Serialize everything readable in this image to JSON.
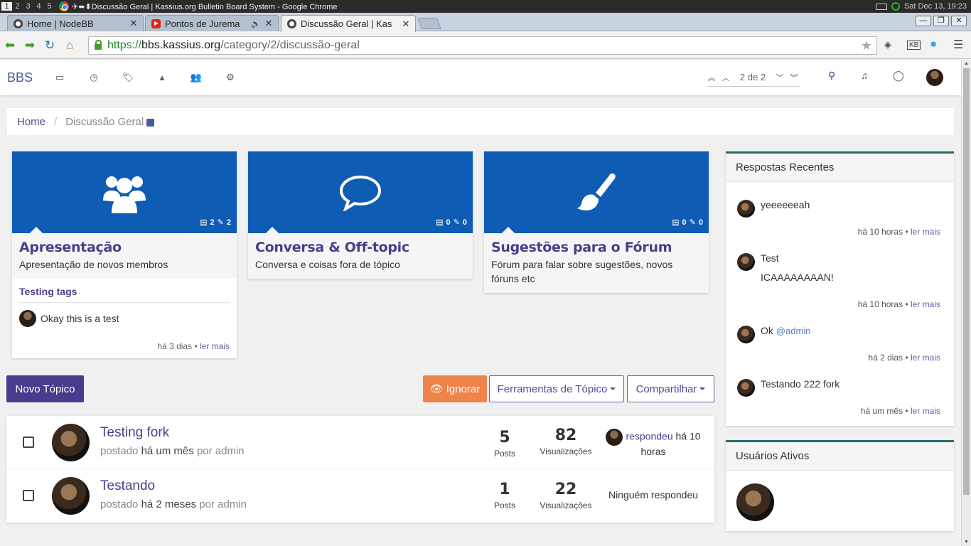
{
  "system": {
    "workspaces": [
      "1",
      "2",
      "3",
      "4",
      "5"
    ],
    "window_title": "✈⬌⬍Discussão Geral | Kassius.org Bulletin Board System - Google Chrome",
    "clock": "Sat Dec 13, 19:23"
  },
  "tabs": [
    {
      "label": "Home | NodeBB",
      "icon": "nodebb-icon"
    },
    {
      "label": "Pontos de Jurema",
      "icon": "youtube-icon"
    },
    {
      "label": "Discussão Geral | Kas",
      "icon": "nodebb-icon",
      "active": true
    }
  ],
  "address": {
    "scheme": "https://",
    "host": "bbs.kassius.org",
    "path": "/category/2/discussão-geral"
  },
  "navbar": {
    "brand": "BBS",
    "icons": [
      "inbox-icon",
      "clock-icon",
      "tags-icon",
      "fire-icon",
      "users-icon",
      "cogs-icon"
    ],
    "pagination": "2 de 2"
  },
  "breadcrumb": {
    "home": "Home",
    "current": "Discussão Geral"
  },
  "categories": [
    {
      "title": "Apresentação",
      "description": "Apresentação de novos membros",
      "topics": "2",
      "posts": "2",
      "icon": "users-icon",
      "teaser": {
        "title": "Testing tags",
        "text": "Okay this is a test",
        "time": "há 3 dias",
        "link": "ler mais"
      }
    },
    {
      "title": "Conversa & Off-topic",
      "description": "Conversa e coisas fora de tópico",
      "topics": "0",
      "posts": "0",
      "icon": "comment-icon"
    },
    {
      "title": "Sugestões para o Fórum",
      "description": "Fórum para falar sobre sugestões, novos fóruns etc",
      "topics": "0",
      "posts": "0",
      "icon": "paintbrush-icon"
    }
  ],
  "actions": {
    "new_topic": "Novo Tópico",
    "ignore": "Ignorar",
    "tools": "Ferramentas de Tópico",
    "share": "Compartilhar"
  },
  "topic_list": [
    {
      "title": "Testing fork",
      "posted": "postado",
      "when": "há um mês",
      "by": "por admin",
      "posts": "5",
      "posts_label": "Posts",
      "views": "82",
      "views_label": "Visualizações",
      "last_link": "respondeu",
      "last_time": "há 10 horas"
    },
    {
      "title": "Testando",
      "posted": "postado",
      "when": "há 2 meses",
      "by": "por admin",
      "posts": "1",
      "posts_label": "Posts",
      "views": "22",
      "views_label": "Visualizações",
      "last_text": "Ninguém respondeu"
    }
  ],
  "sidebar": {
    "recent_title": "Respostas Recentes",
    "recent": [
      {
        "text": "yeeeeeeah",
        "time": "há 10 horas",
        "link": "ler mais"
      },
      {
        "text": "Test",
        "text2": "ICAAAAAAAAN!",
        "time": "há 10 horas",
        "link": "ler mais"
      },
      {
        "text": "Ok",
        "mention": "@admin",
        "time": "há 2 dias",
        "link": "ler mais"
      },
      {
        "text": "Testando 222 fork",
        "time": "há um mês",
        "link": "ler mais"
      }
    ],
    "active_users_title": "Usuários Ativos"
  }
}
